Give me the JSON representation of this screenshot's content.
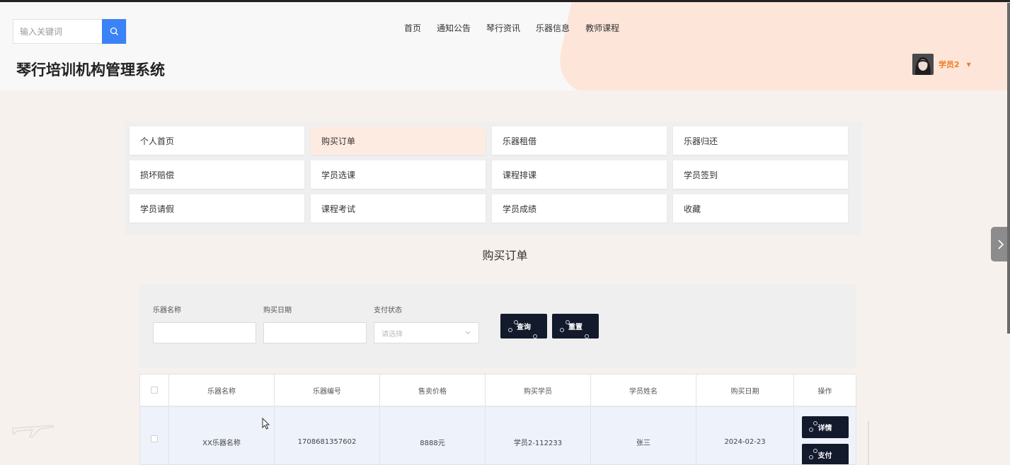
{
  "header": {
    "search_placeholder": "输入关键词",
    "nav": [
      "首页",
      "通知公告",
      "琴行资讯",
      "乐器信息",
      "教师课程"
    ],
    "site_title": "琴行培训机构管理系统",
    "user_name": "学员2",
    "accent_color": "#f07e2a"
  },
  "menu": {
    "items": [
      {
        "label": "个人首页",
        "active": false
      },
      {
        "label": "购买订单",
        "active": true
      },
      {
        "label": "乐器租借",
        "active": false
      },
      {
        "label": "乐器归还",
        "active": false
      },
      {
        "label": "损坏赔偿",
        "active": false
      },
      {
        "label": "学员选课",
        "active": false
      },
      {
        "label": "课程排课",
        "active": false
      },
      {
        "label": "学员签到",
        "active": false
      },
      {
        "label": "学员请假",
        "active": false
      },
      {
        "label": "课程考试",
        "active": false
      },
      {
        "label": "学员成绩",
        "active": false
      },
      {
        "label": "收藏",
        "active": false
      }
    ]
  },
  "page_heading": "购买订单",
  "filter": {
    "instrument_name_label": "乐器名称",
    "purchase_date_label": "购买日期",
    "pay_status_label": "支付状态",
    "pay_status_placeholder": "请选择",
    "query_label": "查询",
    "reset_label": "重置"
  },
  "table": {
    "headers": [
      "乐器名称",
      "乐器编号",
      "售卖价格",
      "购买学员",
      "学员姓名",
      "购买日期",
      "操作"
    ],
    "rows": [
      {
        "instrument_name": "XX乐器名称",
        "instrument_no": "1708681357602",
        "price": "8888元",
        "buyer": "学员2-112233",
        "student_name": "张三",
        "date": "2024-02-23",
        "actions": [
          "详情",
          "支付"
        ]
      }
    ]
  },
  "icons": {
    "search": "search-icon",
    "caret": "caret-down-icon",
    "side_arrow": "chevron-right-icon"
  }
}
